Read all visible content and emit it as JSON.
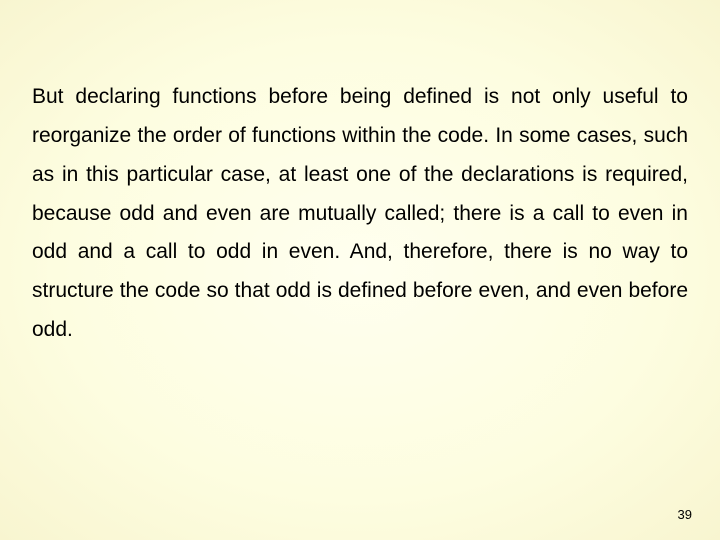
{
  "slide": {
    "body": "But declaring functions before being defined is not only useful to reorganize the order of functions within the code. In some cases, such as in this particular case, at least one of the declarations is required, because odd and even are mutually called; there is a call to even in odd and a call to odd in even. And, therefore, there is no way to structure the code so that odd is defined before even, and even before odd.",
    "page_number": "39"
  }
}
